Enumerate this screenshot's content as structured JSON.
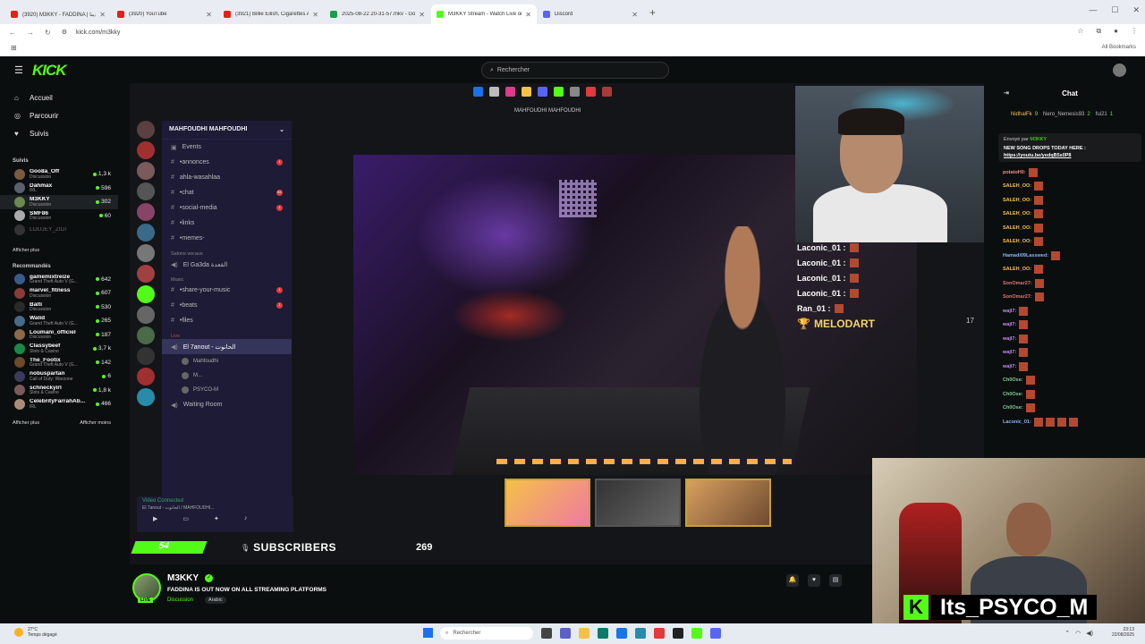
{
  "browser": {
    "tabs": [
      {
        "title": "(3920) M3KKY - FADDINA | فادينا",
        "color": "#e62117"
      },
      {
        "title": "(3920) YouTube",
        "color": "#e62117"
      },
      {
        "title": "(3921) Billie Eilish, Cigarettes Af",
        "color": "#e62117"
      },
      {
        "title": "2025-08-22 20-31-57.mkv - Go",
        "color": "#1a9e4a"
      },
      {
        "title": "M3KKY Stream - Watch Live on",
        "color": "#53fc18",
        "active": true
      },
      {
        "title": "Discord",
        "color": "#5865f2"
      }
    ],
    "url": "kick.com/m3kky",
    "all_bookmarks": "All Bookmarks"
  },
  "kick": {
    "logo": "KICK",
    "search_placeholder": "Rechercher"
  },
  "sidebar": {
    "nav": [
      {
        "label": "Accueil",
        "icon": "home-icon"
      },
      {
        "label": "Parcourir",
        "icon": "compass-icon"
      },
      {
        "label": "Suivis",
        "icon": "heart-icon"
      }
    ],
    "following_title": "Suivis",
    "following": [
      {
        "name": "Goo8a_Off",
        "category": "Discussion",
        "viewers": "1,3 k",
        "color": "#7a5a40"
      },
      {
        "name": "Dahmax",
        "category": "IRL",
        "viewers": "596",
        "color": "#5a6070"
      },
      {
        "name": "M3KKY",
        "category": "Discussion",
        "viewers": "302",
        "color": "#6a8a50",
        "active": true
      },
      {
        "name": "SMF86",
        "category": "Discussion",
        "viewers": "60",
        "color": "#aaaaaa"
      },
      {
        "name": "LOUJEY_ZIDI",
        "category": "",
        "viewers": "",
        "color": "#333333",
        "offline": true
      }
    ],
    "show_more": "Afficher plus",
    "recommended_title": "Recommandés",
    "recommended": [
      {
        "name": "gamemixtreize",
        "category": "Grand Theft Auto V (G...",
        "viewers": "642",
        "color": "#3a5a8a"
      },
      {
        "name": "marvel_fitness",
        "category": "Discussion",
        "viewers": "607",
        "color": "#8a3a3a"
      },
      {
        "name": "Balti",
        "category": "Discussion",
        "viewers": "530",
        "color": "#2a2a2a"
      },
      {
        "name": "Walid",
        "category": "Grand Theft Auto V (G...",
        "viewers": "265",
        "color": "#4a6a8a"
      },
      {
        "name": "Loumani_officiel",
        "category": "Discussion",
        "viewers": "187",
        "color": "#8a6a4a"
      },
      {
        "name": "Classybeef",
        "category": "Slots & Casino",
        "viewers": "3,7 k",
        "color": "#1a8a4a"
      },
      {
        "name": "The_Footix",
        "category": "Grand Theft Auto V (G...",
        "viewers": "142",
        "color": "#6a4a2a"
      },
      {
        "name": "nobuspartan",
        "category": "Call of Duty: Warzone",
        "viewers": "6",
        "color": "#3a3a5a"
      },
      {
        "name": "schneckyirl",
        "category": "Slots & Casino",
        "viewers": "1,8 k",
        "color": "#7a5a5a"
      },
      {
        "name": "CelebrityFarrahAb...",
        "category": "IRL",
        "viewers": "466",
        "color": "#aa8a7a"
      }
    ],
    "show_less": "Afficher moins"
  },
  "stream": {
    "discord": {
      "window_title": "MAHFOUDHI MAHFOUDHI",
      "server_name": "MAHFOUDHI MAHFOUDHI",
      "events": "Events",
      "channels": [
        {
          "label": "•annonces",
          "badge": "1"
        },
        {
          "label": "ahla-wasahlaa",
          "badge": ""
        },
        {
          "label": "•chat",
          "badge": "52"
        },
        {
          "label": "•social-media",
          "badge": "1"
        },
        {
          "label": "•links",
          "badge": ""
        },
        {
          "label": "•memes-",
          "badge": ""
        }
      ],
      "voice_category": "Salons vocaux",
      "voice_channel": "El Ga3da القعدة",
      "music_category": "Music",
      "music_channels": [
        {
          "label": "•share-your-music",
          "badge": "1"
        },
        {
          "label": "•beats",
          "badge": "1"
        },
        {
          "label": "•files",
          "badge": ""
        }
      ],
      "live_category": "Live",
      "live_channel": "El 7anout - الحانوت",
      "live_members": [
        "Mahfoudhi",
        "M...",
        "PSYCO-M"
      ],
      "waiting_room": "Waiting Room",
      "video_connected": "Video Connected",
      "connection_sub": "El 7anout - الحانوت / MAHFOUDHI..."
    },
    "overlay_chat": [
      {
        "user": "Laconic_01 :"
      },
      {
        "user": "Laconic_01 :"
      },
      {
        "user": "Laconic_01 :"
      },
      {
        "user": "Laconic_01 :"
      },
      {
        "user": "Ran_01 :"
      }
    ],
    "overlay_highlight": "MELODART",
    "overlay_number": "17",
    "sub_goal_number": "54",
    "sub_label": "SUBSCRIBERS",
    "sub_count": "269",
    "webcam_name_k": "K",
    "webcam_name": "Its_PSYCO_M"
  },
  "chat": {
    "title": "Chat",
    "leaderboard": [
      {
        "name": "NidhalFk",
        "stat": "9"
      },
      {
        "name": "Nero_Nemesis93",
        "stat": "2"
      },
      {
        "name": "fui21",
        "stat": "1"
      }
    ],
    "pinned_by": "Envoyé par",
    "pinned_user": "M3KKY",
    "pinned_title": "NEW SONG DROPS TODAY HERE :",
    "pinned_link": "https://youtu.be/yedqB5s0P8",
    "messages": [
      {
        "user": "potatoH0:",
        "color": "#f28b82",
        "emotes": 1
      },
      {
        "user": "SALEH_OO:",
        "color": "#f4c148",
        "emotes": 1
      },
      {
        "user": "SALEH_OO:",
        "color": "#f4c148",
        "emotes": 1
      },
      {
        "user": "SALEH_OO:",
        "color": "#f4c148",
        "emotes": 1
      },
      {
        "user": "SALEH_OO:",
        "color": "#f4c148",
        "emotes": 1
      },
      {
        "user": "SALEH_OO:",
        "color": "#f4c148",
        "emotes": 1
      },
      {
        "user": "Hamadi09Lasswed:",
        "color": "#8ab4f8",
        "emotes": 1
      },
      {
        "user": "SALEH_OO:",
        "color": "#f4c148",
        "emotes": 1
      },
      {
        "user": "SonOmar27:",
        "color": "#e57373",
        "emotes": 1
      },
      {
        "user": "SonOmar27:",
        "color": "#e57373",
        "emotes": 1
      },
      {
        "user": "wajl7:",
        "color": "#c58af9",
        "emotes": 1
      },
      {
        "user": "wajl7:",
        "color": "#c58af9",
        "emotes": 1
      },
      {
        "user": "wajl7:",
        "color": "#c58af9",
        "emotes": 1
      },
      {
        "user": "wajl7:",
        "color": "#c58af9",
        "emotes": 1
      },
      {
        "user": "wajl7:",
        "color": "#c58af9",
        "emotes": 1
      },
      {
        "user": "Ch0Ose:",
        "color": "#81c995",
        "emotes": 1
      },
      {
        "user": "Ch0Ose:",
        "color": "#81c995",
        "emotes": 1
      },
      {
        "user": "Ch0Ose:",
        "color": "#81c995",
        "emotes": 1
      },
      {
        "user": "Laconic_01:",
        "color": "#8ab4f8",
        "emotes": 4
      }
    ]
  },
  "channel": {
    "name": "M3KKY",
    "live": "LIVE",
    "title": "FADDINA IS OUT NOW ON ALL STREAMING PLATFORMS",
    "category": "Discussion",
    "tag": "Arabic"
  },
  "windows": {
    "temp": "27°C",
    "weather": "Temps dégagé",
    "search": "Rechercher",
    "time": "23:13",
    "date": "22/08/2025"
  }
}
